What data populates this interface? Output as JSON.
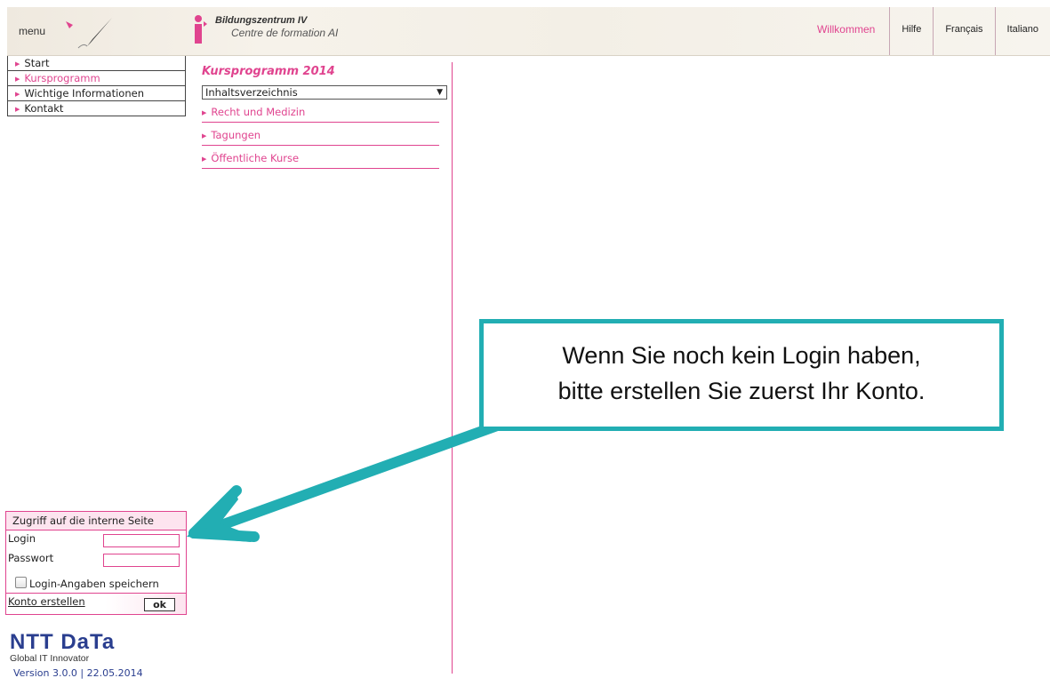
{
  "header": {
    "menu_label": "menu",
    "logo_title": "Bildungszentrum IV",
    "logo_subtitle": "Centre de formation AI",
    "nav": [
      "Willkommen",
      "Hilfe",
      "Français",
      "Italiano"
    ],
    "active_nav": "Willkommen"
  },
  "sidebar": {
    "items": [
      {
        "label": "Start"
      },
      {
        "label": "Kursprogramm"
      },
      {
        "label": "Wichtige Informationen"
      },
      {
        "label": "Kontakt"
      }
    ]
  },
  "content": {
    "title": "Kursprogramm 2014",
    "select_value": "Inhaltsverzeichnis",
    "links": [
      "Recht und Medizin",
      "Tagungen",
      "Öffentliche Kurse"
    ]
  },
  "login": {
    "heading": "Zugriff auf die interne Seite",
    "login_label": "Login",
    "password_label": "Passwort",
    "remember_label": "Login-Angaben speichern",
    "create_account": "Konto erstellen",
    "ok_label": "ok"
  },
  "brand": {
    "name": "NTT DaTa",
    "tagline": "Global IT Innovator",
    "version": "Version 3.0.0 | 22.05.2014"
  },
  "callout": {
    "line1": "Wenn Sie noch kein Login haben,",
    "line2": "bitte erstellen Sie zuerst Ihr Konto."
  },
  "colors": {
    "accent": "#e0448f",
    "callout_border": "#22aeb3",
    "brand": "#2a3e8f"
  }
}
